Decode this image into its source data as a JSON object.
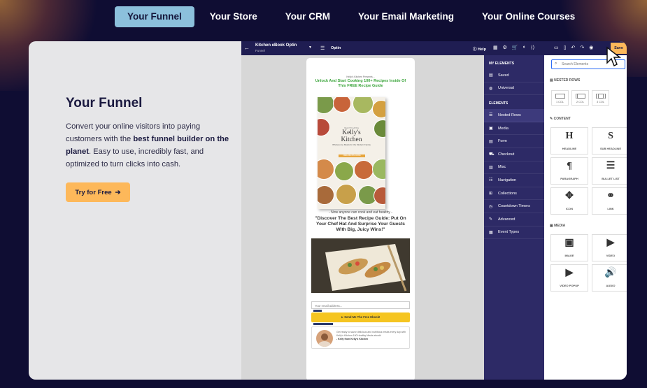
{
  "nav": {
    "tabs": [
      {
        "label": "Your Funnel",
        "active": true
      },
      {
        "label": "Your Store"
      },
      {
        "label": "Your CRM"
      },
      {
        "label": "Your Email Marketing"
      },
      {
        "label": "Your Online Courses"
      }
    ]
  },
  "hero": {
    "title": "Your Funnel",
    "text_part1": "Convert your online visitors into paying customers with the ",
    "text_bold": "best funnel builder on the planet",
    "text_part2": ". Easy to use, incredibly fast, and optimized to turn clicks into cash.",
    "cta_label": "Try for Free",
    "cta_icon": "arrow-right-icon"
  },
  "editor": {
    "funnel_name": "Kitchen eBook Optin",
    "funnel_type": "Funnel",
    "page_name": "Optin",
    "help_label": "Help",
    "save_label": "Save",
    "accent_color": "#fdb85a"
  },
  "preview": {
    "small_text": "Kelly's Kitchen Presents...",
    "headline": "Unlock And Start Cooking 100+ Recipes Inside Of This FREE Recipe Guide",
    "book_series": "HEALTHY EATING",
    "book_title": "Kelly's Kitchen",
    "book_subtitle": "Wholesome Meals for the Modern Family",
    "book_badge": "FREE RECIPE GUIDE",
    "now_text": "- Now anyone can cook and eat healthy -",
    "discover": "\"Discover The Best Recipe Guide: Put On Your Chef Hat And Surprise Your Guests With Big, Juicy Wins!\"",
    "email_placeholder": "Your email address...",
    "cta": "Send Me The Free Ebook!",
    "testimonial": "Get ready to savor delicious and nutritious meals every day with Kelly's Kitchen 100 Healthy Meals ebook!",
    "testimonial_author": "- Kelly from Kelly's Kitchen"
  },
  "sidebar": {
    "my_elements_heading": "MY ELEMENTS",
    "my_elements": [
      {
        "label": "Saved",
        "icon": "bookmark-icon"
      },
      {
        "label": "Universal",
        "icon": "globe-icon"
      }
    ],
    "elements_heading": "ELEMENTS",
    "elements": [
      {
        "label": "Nested Rows",
        "icon": "rows-icon",
        "active": true
      },
      {
        "label": "Media",
        "icon": "image-icon"
      },
      {
        "label": "Form",
        "icon": "form-icon"
      },
      {
        "label": "Checkout",
        "icon": "cart-icon"
      },
      {
        "label": "Misc",
        "icon": "misc-icon"
      },
      {
        "label": "Navigation",
        "icon": "navigation-icon"
      },
      {
        "label": "Collections",
        "icon": "collections-icon"
      },
      {
        "label": "Countdown Timers",
        "icon": "timer-icon"
      },
      {
        "label": "Advanced",
        "icon": "advanced-icon"
      },
      {
        "label": "Event Types",
        "icon": "calendar-icon"
      }
    ]
  },
  "elements_panel": {
    "search_placeholder": "Search Elements",
    "nested_rows_heading": "NESTED ROWS",
    "columns": [
      "1 COL",
      "2 COL",
      "3 COL"
    ],
    "content_heading": "CONTENT",
    "content": [
      {
        "label": "HEADLINE",
        "glyph": "H",
        "icon": "headline-icon"
      },
      {
        "label": "SUB HEADLINE",
        "glyph": "S",
        "icon": "subheadline-icon"
      },
      {
        "label": "PARAGRAPH",
        "glyph": "¶",
        "icon": "paragraph-icon"
      },
      {
        "label": "BULLET LIST",
        "glyph": "☰",
        "icon": "bullet-list-icon"
      },
      {
        "label": "ICON",
        "glyph": "✥",
        "icon": "icon-element-icon"
      },
      {
        "label": "LINK",
        "glyph": "⚭",
        "icon": "link-icon"
      }
    ],
    "media_heading": "MEDIA",
    "media": [
      {
        "label": "IMAGE",
        "glyph": "▣",
        "icon": "image-icon"
      },
      {
        "label": "VIDEO",
        "glyph": "▶",
        "icon": "video-icon"
      },
      {
        "label": "VIDEO POPUP",
        "glyph": "▶",
        "icon": "video-popup-icon"
      },
      {
        "label": "AUDIO",
        "glyph": "🔊",
        "icon": "audio-icon"
      }
    ]
  }
}
